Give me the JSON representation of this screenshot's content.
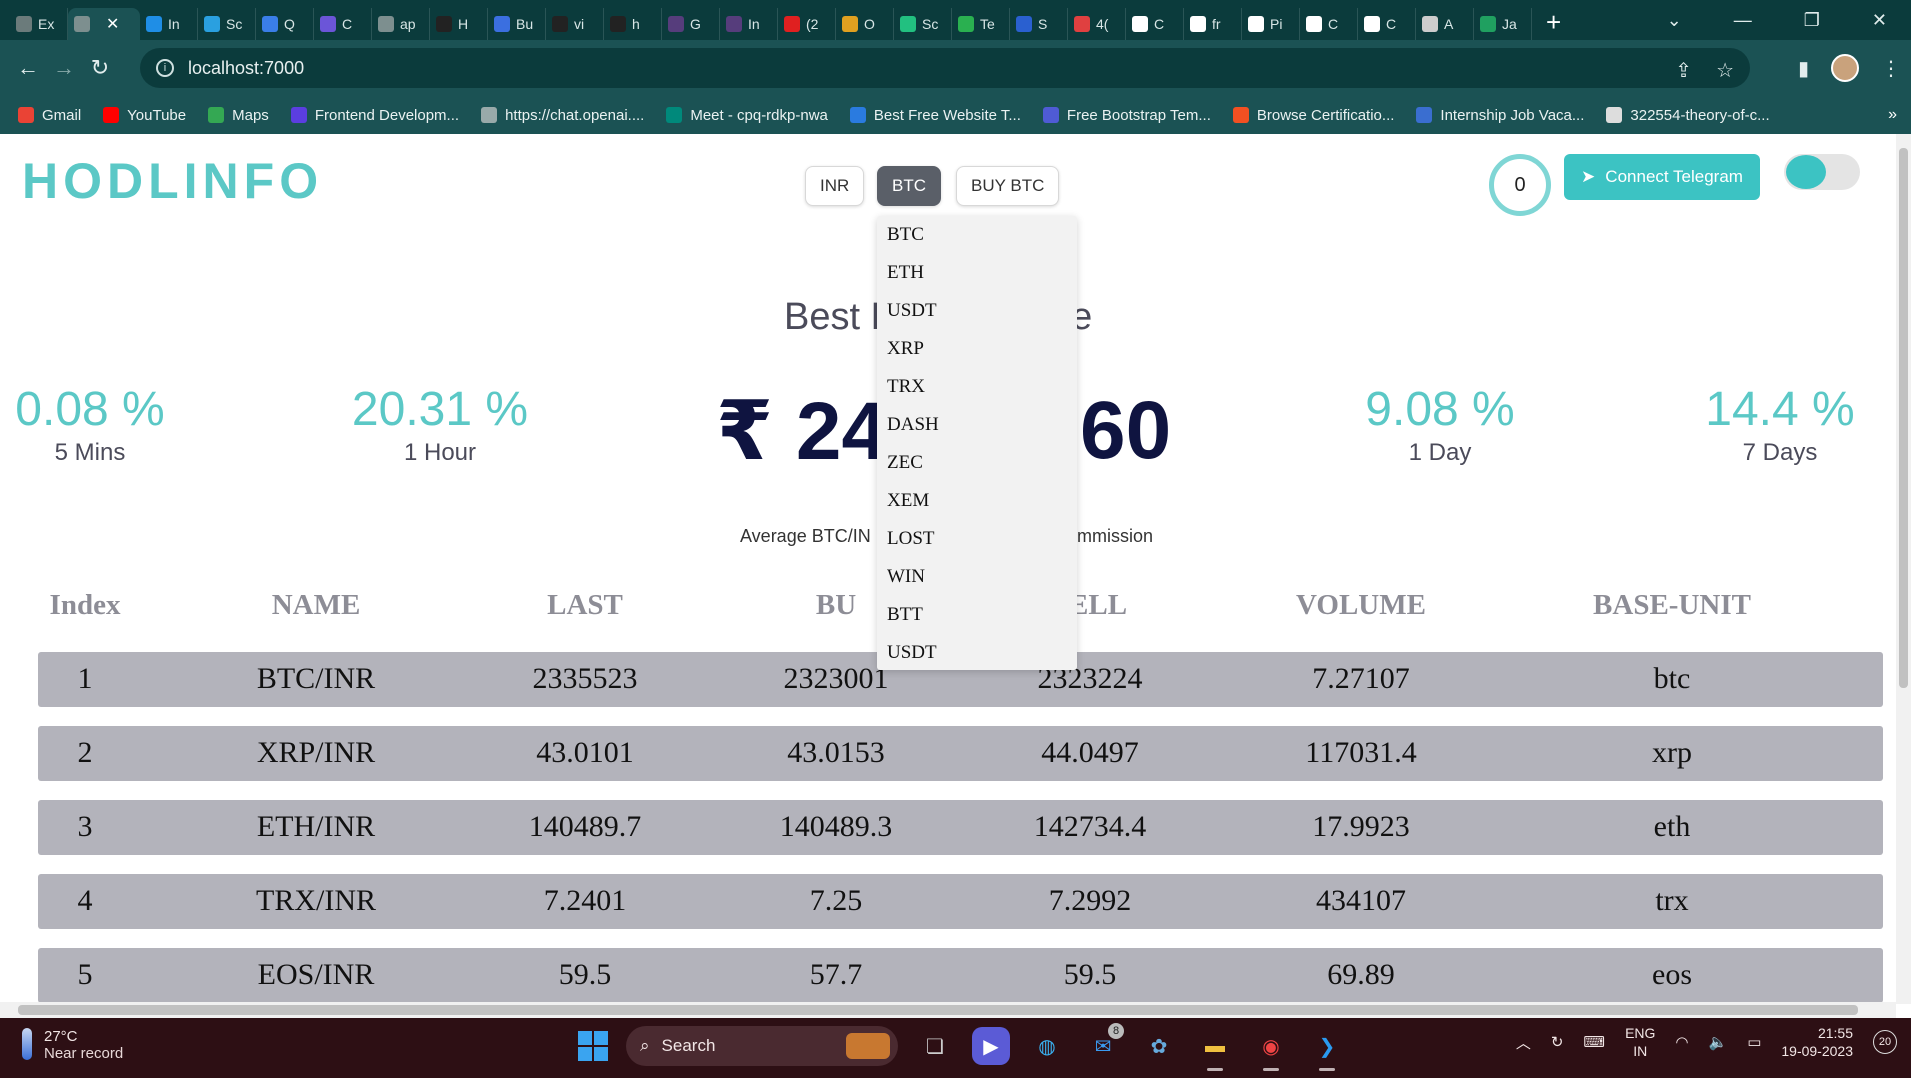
{
  "browser": {
    "tabs": [
      {
        "label": "Ex",
        "color": "#6b7b7b"
      },
      {
        "label": "",
        "color": "#7d8f8f",
        "active": true
      },
      {
        "label": "In",
        "color": "#1f8ee6"
      },
      {
        "label": "Sc",
        "color": "#2aa0e0"
      },
      {
        "label": "Q",
        "color": "#3a7ee8"
      },
      {
        "label": "C",
        "color": "#6b55d8"
      },
      {
        "label": "ap",
        "color": "#7d8f8f"
      },
      {
        "label": "H",
        "color": "#222222"
      },
      {
        "label": "Bu",
        "color": "#3b6fe0"
      },
      {
        "label": "vi",
        "color": "#222222"
      },
      {
        "label": "h",
        "color": "#222222"
      },
      {
        "label": "G",
        "color": "#563d7c"
      },
      {
        "label": "In",
        "color": "#563d7c"
      },
      {
        "label": "(2",
        "color": "#e02020"
      },
      {
        "label": "O",
        "color": "#e0a020"
      },
      {
        "label": "Sc",
        "color": "#22c080"
      },
      {
        "label": "Te",
        "color": "#2ab050"
      },
      {
        "label": "S",
        "color": "#2a60d0"
      },
      {
        "label": "4(",
        "color": "#e04040"
      },
      {
        "label": "C",
        "color": "#ffffff"
      },
      {
        "label": "fr",
        "color": "#ffffff"
      },
      {
        "label": "Pi",
        "color": "#ffffff"
      },
      {
        "label": "C",
        "color": "#ffffff"
      },
      {
        "label": "C",
        "color": "#ffffff"
      },
      {
        "label": "A",
        "color": "#cccccc"
      },
      {
        "label": "Ja",
        "color": "#20a060"
      }
    ],
    "url": "localhost:7000",
    "bookmarks": [
      {
        "label": "Gmail",
        "color": "#ea4335"
      },
      {
        "label": "YouTube",
        "color": "#ff0000"
      },
      {
        "label": "Maps",
        "color": "#34a853"
      },
      {
        "label": "Frontend Developm...",
        "color": "#5b3ee0"
      },
      {
        "label": "https://chat.openai....",
        "color": "#9aa"
      },
      {
        "label": "Meet - cpq-rdkp-nwa",
        "color": "#00897b"
      },
      {
        "label": "Best Free Website T...",
        "color": "#2a7be0"
      },
      {
        "label": "Free Bootstrap Tem...",
        "color": "#4f5bd5"
      },
      {
        "label": "Browse Certificatio...",
        "color": "#f25022"
      },
      {
        "label": "Internship Job Vaca...",
        "color": "#3a6ed0"
      },
      {
        "label": "322554-theory-of-c...",
        "color": "#dddddd"
      }
    ]
  },
  "app": {
    "logo": "HODLINFO",
    "currency_buttons": {
      "inr": "INR",
      "btc": "BTC",
      "buy": "BUY BTC"
    },
    "timer": "0",
    "telegram_label": "Connect Telegram",
    "heading_left": "Best P",
    "heading_right": "de",
    "stats": [
      {
        "pct": "0.08 %",
        "label": "5 Mins"
      },
      {
        "pct": "20.31 %",
        "label": "1 Hour"
      },
      {
        "pct": "9.08 %",
        "label": "1 Day"
      },
      {
        "pct": "14.4 %",
        "label": "7 Days"
      }
    ],
    "price_left": "₹ 24",
    "price_right": "60",
    "subtext_left": "Average BTC/IN",
    "subtext_right": "mmission",
    "dropdown": [
      "BTC",
      "ETH",
      "USDT",
      "XRP",
      "TRX",
      "DASH",
      "ZEC",
      "XEM",
      "LOST",
      "WIN",
      "BTT",
      "USDT"
    ],
    "table": {
      "headers": [
        "Index",
        "NAME",
        "LAST",
        "BU",
        "SELL",
        "VOLUME",
        "BASE-UNIT"
      ],
      "rows": [
        [
          "1",
          "BTC/INR",
          "2335523",
          "2323001",
          "2323224",
          "7.27107",
          "btc"
        ],
        [
          "2",
          "XRP/INR",
          "43.0101",
          "43.0153",
          "44.0497",
          "117031.4",
          "xrp"
        ],
        [
          "3",
          "ETH/INR",
          "140489.7",
          "140489.3",
          "142734.4",
          "17.9923",
          "eth"
        ],
        [
          "4",
          "TRX/INR",
          "7.2401",
          "7.25",
          "7.2992",
          "434107",
          "trx"
        ],
        [
          "5",
          "EOS/INR",
          "59.5",
          "57.7",
          "59.5",
          "69.89",
          "eos"
        ]
      ]
    }
  },
  "taskbar": {
    "temp": "27°C",
    "weather": "Near record",
    "search": "Search",
    "mail_badge": "8",
    "lang1": "ENG",
    "lang2": "IN",
    "time": "21:55",
    "date": "19-09-2023",
    "notifications": "20"
  }
}
